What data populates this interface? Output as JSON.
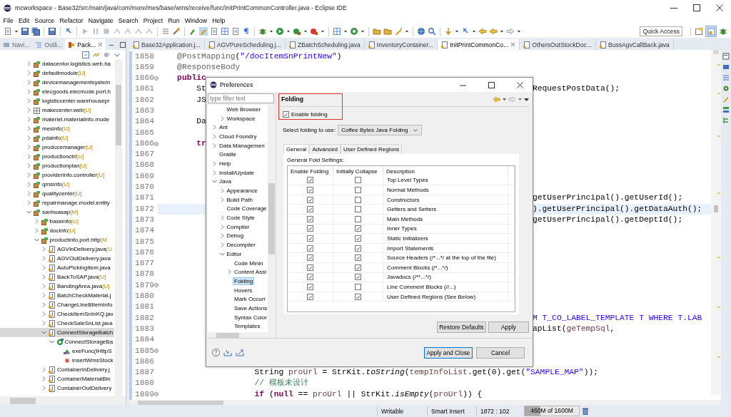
{
  "window": {
    "title": "mcworkspace - Base32/src/main/java/com/more/mes/base/wms/receive/func/InitPrintCommonController.java - Eclipse IDE"
  },
  "menu": [
    "File",
    "Edit",
    "Source",
    "Refactor",
    "Navigate",
    "Search",
    "Project",
    "Run",
    "Window",
    "Help"
  ],
  "toolbar": {
    "quick_access": "Quick Access"
  },
  "explorer": {
    "tabs": [
      {
        "label": "Navi...",
        "selected": false
      },
      {
        "label": "Outli...",
        "selected": false
      },
      {
        "label": "Pack...",
        "selected": true
      }
    ],
    "tree": [
      {
        "label": "datacentor.logistics.web.ha",
        "kind": "project",
        "expanded": false,
        "selected": false
      },
      {
        "label": "defaultmodule",
        "status": "[U]",
        "kind": "project",
        "expanded": false,
        "selected": false
      },
      {
        "label": "devicemanagementsystem",
        "kind": "project",
        "expanded": false,
        "selected": false
      },
      {
        "label": "elecgoods.elecmode.port.h",
        "kind": "project",
        "expanded": false,
        "selected": false
      },
      {
        "label": "logisticcenter.warehousepr",
        "kind": "project",
        "expanded": false,
        "selected": false
      },
      {
        "label": "makecenter.web",
        "status": "[U]",
        "kind": "module",
        "expanded": false,
        "selected": false
      },
      {
        "label": "materiel.materialinfo.mode",
        "kind": "project",
        "expanded": false,
        "selected": false
      },
      {
        "label": "mesinfo",
        "status": "[U]",
        "kind": "project",
        "expanded": false,
        "selected": false
      },
      {
        "label": "pdainfo",
        "status": "[U]",
        "kind": "project",
        "expanded": false,
        "selected": false
      },
      {
        "label": "producemanager",
        "status": "[U]",
        "kind": "project",
        "expanded": false,
        "selected": false
      },
      {
        "label": "productionctrl",
        "status": "[U]",
        "kind": "project",
        "expanded": false,
        "selected": false
      },
      {
        "label": "productionplan",
        "status": "[U]",
        "kind": "project",
        "expanded": false,
        "selected": false
      },
      {
        "label": "providerinfo.controller",
        "status": "[U]",
        "kind": "project",
        "expanded": false,
        "selected": false
      },
      {
        "label": "qmsinfo",
        "status": "[U]",
        "kind": "project",
        "expanded": false,
        "selected": false
      },
      {
        "label": "qualitycenter",
        "status": "[U]",
        "kind": "project",
        "expanded": false,
        "selected": false
      },
      {
        "label": "repairmanage.model.entity",
        "kind": "project",
        "expanded": false,
        "selected": false
      },
      {
        "label": "sanhuasap",
        "status": "[M]",
        "kind": "project",
        "expanded": true,
        "selected": false,
        "children": [
          {
            "label": "baseinfo",
            "status": "[U]",
            "kind": "package",
            "expanded": false,
            "selected": false
          },
          {
            "label": "docinfo",
            "status": "[U]",
            "kind": "package",
            "expanded": false,
            "selected": false
          },
          {
            "label": "productinfo.port.http",
            "status": "[M",
            "kind": "package",
            "expanded": true,
            "selected": false,
            "children": [
              {
                "label": "AGVInDelivery.java",
                "status": "[U",
                "kind": "java-file",
                "expanded": false,
                "selected": false
              },
              {
                "label": "AGVOutDelivery.java",
                "kind": "java-file",
                "expanded": false,
                "selected": false
              },
              {
                "label": "AutoPickingItem.java",
                "kind": "java-file",
                "expanded": false,
                "selected": false
              },
              {
                "label": "BackToSAP.java",
                "status": "[U]",
                "kind": "java-file",
                "expanded": false,
                "selected": false
              },
              {
                "label": "BandingArea.java",
                "status": "[U]",
                "kind": "java-file",
                "expanded": false,
                "selected": false
              },
              {
                "label": "BatchCheckMaterial.j",
                "kind": "java-file",
                "expanded": false,
                "selected": false
              },
              {
                "label": "ChangeLineBItemInfo",
                "kind": "java-file",
                "expanded": false,
                "selected": false
              },
              {
                "label": "CheckItemSnInKQ.jav",
                "kind": "java-file",
                "expanded": false,
                "selected": false
              },
              {
                "label": "CheckSaleSnList.java",
                "kind": "java-file",
                "expanded": false,
                "selected": false
              },
              {
                "label": "ConnectStorageBatch",
                "kind": "java-file",
                "expanded": true,
                "selected": true,
                "children": [
                  {
                    "label": "ConnectStorageBa",
                    "kind": "class",
                    "expanded": true,
                    "selected": false,
                    "children": [
                      {
                        "label": "exeFunc(IHttpS",
                        "kind": "method",
                        "selected": false
                      },
                      {
                        "label": "insertWmsStock",
                        "kind": "field",
                        "selected": false
                      }
                    ]
                  }
                ]
              },
              {
                "label": "ContainerInDelivery.j",
                "kind": "java-file",
                "expanded": false,
                "selected": false
              },
              {
                "label": "ContainerMaterialBin",
                "kind": "java-file",
                "expanded": false,
                "selected": false
              },
              {
                "label": "ContainerOutDelivery",
                "kind": "java-file",
                "expanded": false,
                "selected": false
              }
            ]
          }
        ]
      }
    ]
  },
  "editor": {
    "tabs": [
      {
        "label": "Base32Application.j...",
        "selected": false
      },
      {
        "label": "AGVPureScheduling.j...",
        "selected": false
      },
      {
        "label": "ZBatchScheduling.java",
        "selected": false
      },
      {
        "label": "InventoryContainer...",
        "selected": false
      },
      {
        "label": "InitPrintCommonCo...",
        "selected": true
      },
      {
        "label": "OthersOutStockDoc...",
        "selected": false
      },
      {
        "label": "BussAgvCallBack.java",
        "selected": false
      }
    ],
    "lines": [
      {
        "number": "1858",
        "fold": false,
        "current": false,
        "left": [
          {
            "text": "    @PostMapping",
            "kind": "annotation"
          },
          {
            "text": "(",
            "kind": "plain"
          },
          {
            "text": "\"/docItemSnPrintNew\"",
            "kind": "string"
          },
          {
            "text": ")",
            "kind": "plain"
          }
        ]
      },
      {
        "number": "1859",
        "fold": false,
        "current": false,
        "left": [
          {
            "text": "    @ResponseBody",
            "kind": "annotation"
          }
        ]
      },
      {
        "number": "1860",
        "fold": true,
        "current": false,
        "left": [
          {
            "text": "    public",
            "kind": "keyword"
          }
        ]
      },
      {
        "number": "1861",
        "fold": false,
        "current": false,
        "left": [
          {
            "text": "        St",
            "kind": "plain"
          }
        ],
        "right": [
          {
            "text": "RequestPostData();",
            "kind": "plain"
          }
        ]
      },
      {
        "number": "1862",
        "fold": false,
        "current": false,
        "left": [
          {
            "text": "        JS",
            "kind": "plain"
          }
        ]
      },
      {
        "number": "1863",
        "fold": false,
        "current": false
      },
      {
        "number": "1864",
        "fold": false,
        "current": false,
        "left": [
          {
            "text": "        Da",
            "kind": "plain"
          }
        ]
      },
      {
        "number": "1865",
        "fold": false,
        "current": false
      },
      {
        "number": "1866",
        "fold": true,
        "current": false,
        "left": [
          {
            "text": "        tr",
            "kind": "keyword"
          }
        ]
      },
      {
        "number": "1867",
        "fold": false,
        "current": false
      },
      {
        "number": "1868",
        "fold": false,
        "current": false
      },
      {
        "number": "1869",
        "fold": false,
        "current": false
      },
      {
        "number": "1870",
        "fold": false,
        "current": false
      },
      {
        "number": "1871",
        "fold": false,
        "current": false,
        "right": [
          {
            "text": "getUserPrincipal().getUserId();",
            "kind": "plain"
          }
        ]
      },
      {
        "number": "1872",
        "fold": false,
        "current": true,
        "right": [
          {
            "text": ").getUserPrincipal().getDataAuth();",
            "kind": "plain"
          }
        ]
      },
      {
        "number": "1873",
        "fold": false,
        "current": false,
        "right": [
          {
            "text": "getUserPrincipal().getDeptId();",
            "kind": "plain"
          }
        ]
      },
      {
        "number": "1874",
        "fold": false,
        "current": false
      },
      {
        "number": "1875",
        "fold": false,
        "current": false
      },
      {
        "number": "1876",
        "fold": false,
        "current": false
      },
      {
        "number": "1877",
        "fold": false,
        "current": false
      },
      {
        "number": "1878",
        "fold": false,
        "current": false
      },
      {
        "number": "1879",
        "fold": true,
        "current": false
      },
      {
        "number": "1880",
        "fold": false,
        "current": false
      },
      {
        "number": "1881",
        "fold": false,
        "current": false
      },
      {
        "number": "1882",
        "fold": false,
        "current": false,
        "right": [
          {
            "text": "M T_CO_LABEL_TEMPLATE T WHERE T.LAB",
            "kind": "string"
          }
        ]
      },
      {
        "number": "1883",
        "fold": false,
        "current": false,
        "right": [
          {
            "text": "apList(",
            "kind": "plain"
          },
          {
            "text": "geTempSql",
            "kind": "local"
          },
          {
            "text": ",",
            "kind": "plain"
          }
        ]
      },
      {
        "number": "1884",
        "fold": false,
        "current": false
      },
      {
        "number": "1885",
        "fold": true,
        "current": false
      },
      {
        "number": "1886",
        "fold": false,
        "current": false
      },
      {
        "number": "1887",
        "fold": false,
        "current": false,
        "left": [
          {
            "text": "                    String ",
            "kind": "plain"
          },
          {
            "text": "proUrl",
            "kind": "local"
          },
          {
            "text": " = StrKit.",
            "kind": "plain"
          },
          {
            "text": "toString",
            "kind": "static"
          },
          {
            "text": "(",
            "kind": "plain"
          },
          {
            "text": "tempInfoList",
            "kind": "local"
          },
          {
            "text": ".get(0).get(",
            "kind": "plain"
          },
          {
            "text": "\"SAMPLE_MAP\"",
            "kind": "string"
          },
          {
            "text": "));",
            "kind": "plain"
          }
        ]
      },
      {
        "number": "1888",
        "fold": false,
        "current": false,
        "left": [
          {
            "text": "                    // 模板未设计",
            "kind": "comment"
          }
        ]
      },
      {
        "number": "1889",
        "fold": true,
        "current": false,
        "left": [
          {
            "text": "                    if",
            "kind": "keyword"
          },
          {
            "text": " (",
            "kind": "plain"
          },
          {
            "text": "null",
            "kind": "keyword"
          },
          {
            "text": " == ",
            "kind": "plain"
          },
          {
            "text": "proUrl",
            "kind": "local"
          },
          {
            "text": " || StrKit.",
            "kind": "plain"
          },
          {
            "text": "isEmpty",
            "kind": "static"
          },
          {
            "text": "(",
            "kind": "plain"
          },
          {
            "text": "proUrl",
            "kind": "local"
          },
          {
            "text": ")) {",
            "kind": "plain"
          }
        ]
      }
    ]
  },
  "preferences": {
    "title": "Preferences",
    "filter": {
      "placeholder": "type filter text"
    },
    "tree": {
      "scrolled_children": [
        {
          "label": "Web Browser",
          "expandable": false,
          "selected": false
        },
        {
          "label": "Workspace",
          "expandable": true,
          "expanded": false,
          "selected": false
        }
      ],
      "items": [
        {
          "label": "Ant",
          "expandable": true,
          "expanded": false,
          "selected": false
        },
        {
          "label": "Cloud Foundry",
          "expandable": true,
          "expanded": false,
          "selected": false
        },
        {
          "label": "Data Managemen",
          "expandable": true,
          "expanded": false,
          "selected": false
        },
        {
          "label": "Gradle",
          "expandable": false,
          "selected": false
        },
        {
          "label": "Help",
          "expandable": true,
          "expanded": false,
          "selected": false
        },
        {
          "label": "Install/Update",
          "expandable": true,
          "expanded": false,
          "selected": false
        },
        {
          "label": "Java",
          "expandable": true,
          "expanded": true,
          "selected": false,
          "children": [
            {
              "label": "Appearance",
              "expandable": true,
              "expanded": false,
              "selected": false
            },
            {
              "label": "Build Path",
              "expandable": true,
              "expanded": false,
              "selected": false
            },
            {
              "label": "Code Coverage",
              "expandable": false,
              "selected": false
            },
            {
              "label": "Code Style",
              "expandable": true,
              "expanded": false,
              "selected": false
            },
            {
              "label": "Compiler",
              "expandable": true,
              "expanded": false,
              "selected": false
            },
            {
              "label": "Debug",
              "expandable": true,
              "expanded": false,
              "selected": false
            },
            {
              "label": "Decompiler",
              "expandable": true,
              "expanded": false,
              "selected": false
            },
            {
              "label": "Editor",
              "expandable": true,
              "expanded": true,
              "selected": false,
              "children": [
                {
                  "label": "Code Minin",
                  "expandable": false,
                  "selected": false
                },
                {
                  "label": "Content Assi",
                  "expandable": true,
                  "expanded": false,
                  "selected": false
                },
                {
                  "label": "Folding",
                  "expandable": false,
                  "selected": true
                },
                {
                  "label": "Hovers",
                  "expandable": false,
                  "selected": false
                },
                {
                  "label": "Mark Occurr",
                  "expandable": false,
                  "selected": false
                },
                {
                  "label": "Save Actions",
                  "expandable": false,
                  "selected": false
                },
                {
                  "label": "Syntax Color",
                  "expandable": false,
                  "selected": false
                },
                {
                  "label": "Templates",
                  "expandable": false,
                  "selected": false
                }
              ]
            }
          ]
        }
      ]
    },
    "page": {
      "title": "Folding",
      "highlighted": true,
      "enable": {
        "label": "Enable folding",
        "checked": true
      },
      "select": {
        "label": "Select folding to use:",
        "value": "Coffee Bytes Java Folding"
      },
      "tabs": [
        {
          "label": "General",
          "selected": true
        },
        {
          "label": "Advanced",
          "selected": false
        },
        {
          "label": "User Defined Regions",
          "selected": false
        }
      ],
      "group_label": "General Fold Settings:",
      "columns": [
        "Enable Folding",
        "Initially Collapse",
        "Description"
      ],
      "rows": [
        {
          "enabled": true,
          "collapse": false,
          "description": "Top Level Types"
        },
        {
          "enabled": true,
          "collapse": false,
          "description": "Normal Methods"
        },
        {
          "enabled": true,
          "collapse": false,
          "description": "Constructors"
        },
        {
          "enabled": true,
          "collapse": false,
          "description": "Getters and Setters"
        },
        {
          "enabled": true,
          "collapse": false,
          "description": "Main Methods"
        },
        {
          "enabled": true,
          "collapse": true,
          "description": "Inner Types"
        },
        {
          "enabled": true,
          "collapse": true,
          "description": "Static Initializers"
        },
        {
          "enabled": true,
          "collapse": true,
          "description": "Import Statements"
        },
        {
          "enabled": true,
          "collapse": true,
          "description": "Source Headers (/*...*/ at the top of the file)"
        },
        {
          "enabled": true,
          "collapse": true,
          "description": "Comment Blocks (/*...*/)"
        },
        {
          "enabled": true,
          "collapse": true,
          "description": "Javadocs (/**...*/)"
        },
        {
          "enabled": true,
          "collapse": false,
          "description": "Line Comment Blocks (//...)"
        },
        {
          "enabled": true,
          "collapse": true,
          "description": "User Defined Regions (See Below)"
        }
      ],
      "buttons": [
        "Restore Defaults",
        "Apply"
      ]
    },
    "buttons": [
      {
        "label": "Apply and Close",
        "default": true
      },
      {
        "label": "Cancel",
        "default": false
      }
    ]
  },
  "status_bar": {
    "items": [
      "Writable",
      "Smart Insert",
      "1872 : 102"
    ],
    "memory": {
      "text": "460M of 1600M",
      "level": 0.29
    }
  }
}
